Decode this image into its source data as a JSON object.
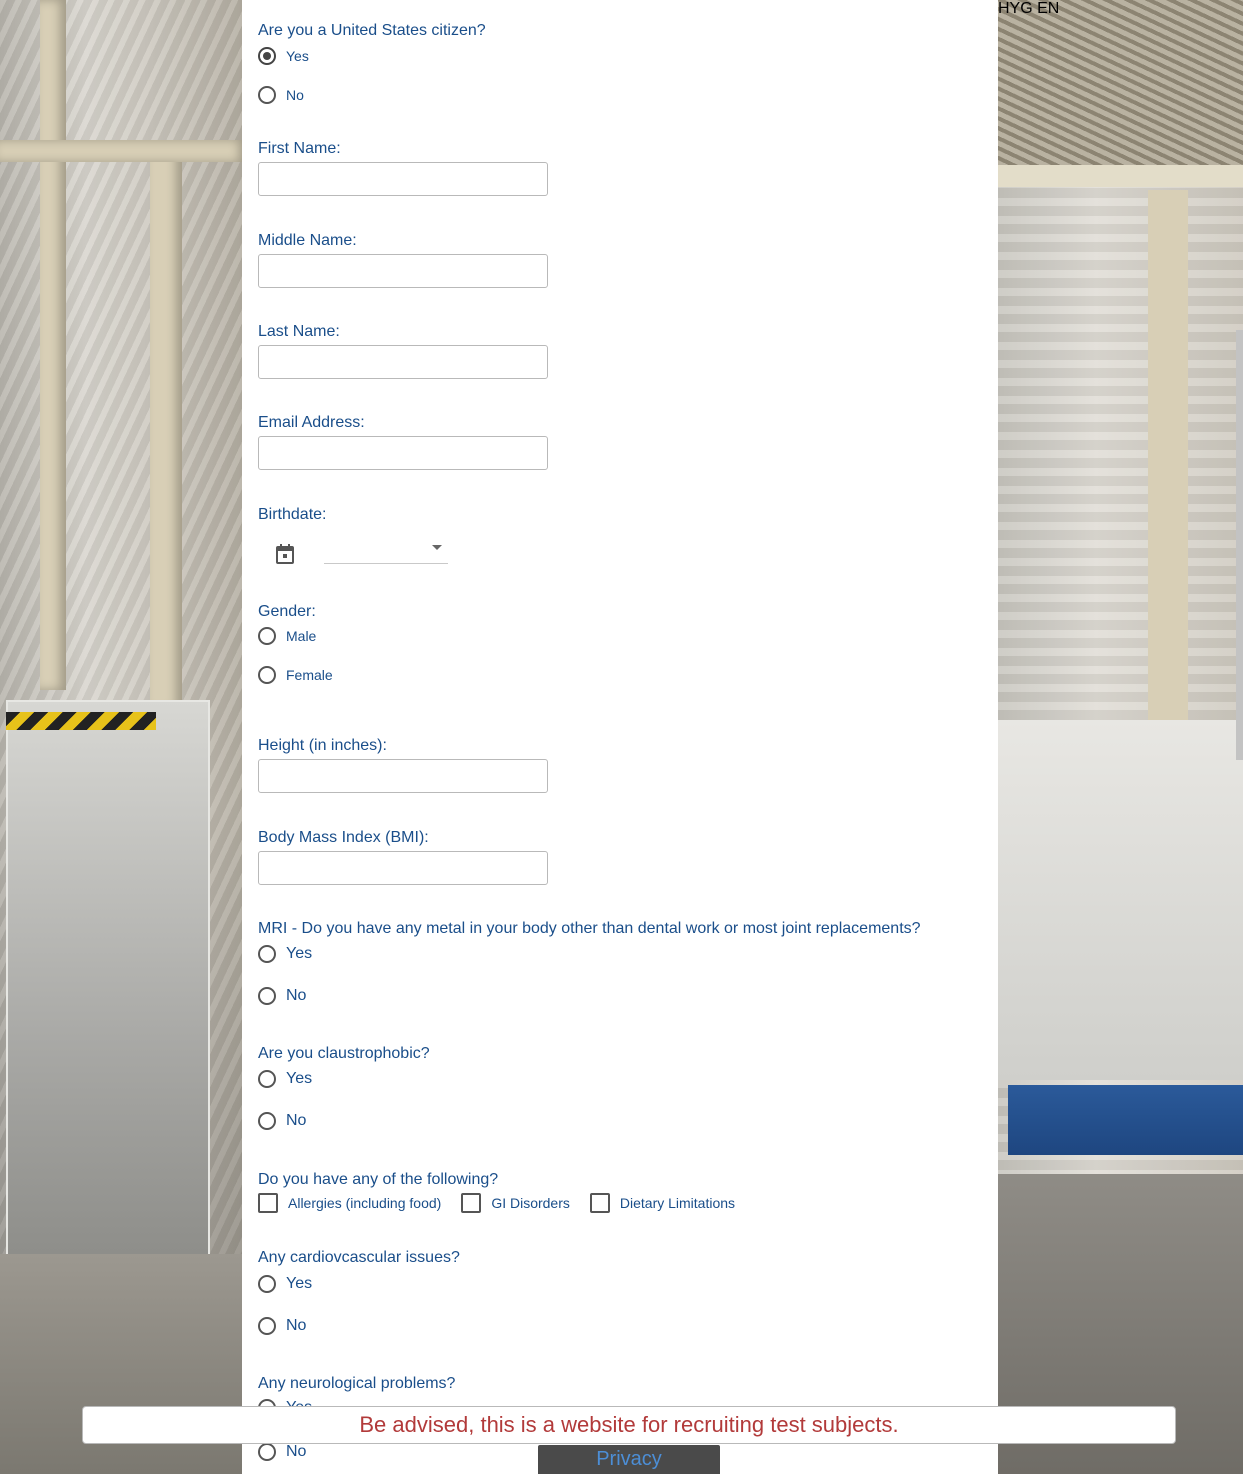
{
  "form": {
    "citizen": {
      "question": "Are you a United States citizen?",
      "options": [
        "Yes",
        "No"
      ],
      "selected": "Yes"
    },
    "first_name": {
      "label": "First Name:",
      "value": ""
    },
    "middle_name": {
      "label": "Middle Name:",
      "value": ""
    },
    "last_name": {
      "label": "Last Name:",
      "value": ""
    },
    "email": {
      "label": "Email Address:",
      "value": ""
    },
    "birthdate": {
      "label": "Birthdate:",
      "value": ""
    },
    "gender": {
      "label": "Gender:",
      "options": [
        "Male",
        "Female"
      ]
    },
    "height": {
      "label": "Height (in inches):",
      "value": ""
    },
    "bmi": {
      "label": "Body Mass Index (BMI):",
      "value": ""
    },
    "mri": {
      "question": "MRI - Do you have any metal in your body other than dental work or most joint replacements?",
      "options": [
        "Yes",
        "No"
      ]
    },
    "claustrophobic": {
      "question": "Are you claustrophobic?",
      "options": [
        "Yes",
        "No"
      ]
    },
    "conditions": {
      "question": "Do you have any of the following?",
      "options": [
        "Allergies (including food)",
        "GI Disorders",
        "Dietary Limitations"
      ]
    },
    "cardio": {
      "question": "Any cardiovcascular issues?",
      "options": [
        "Yes",
        "No"
      ]
    },
    "neuro": {
      "question": "Any neurological problems?",
      "options": [
        "Yes",
        "No"
      ]
    }
  },
  "advisory": "Be advised, this is a website for recruiting test subjects.",
  "privacy_label": "Privacy",
  "background_text": "HYG EN",
  "colors": {
    "label": "#1a4e8a",
    "advisory": "#b23a3a",
    "privacy_bg": "#4a4a4a",
    "privacy_text": "#4c8ed6"
  }
}
